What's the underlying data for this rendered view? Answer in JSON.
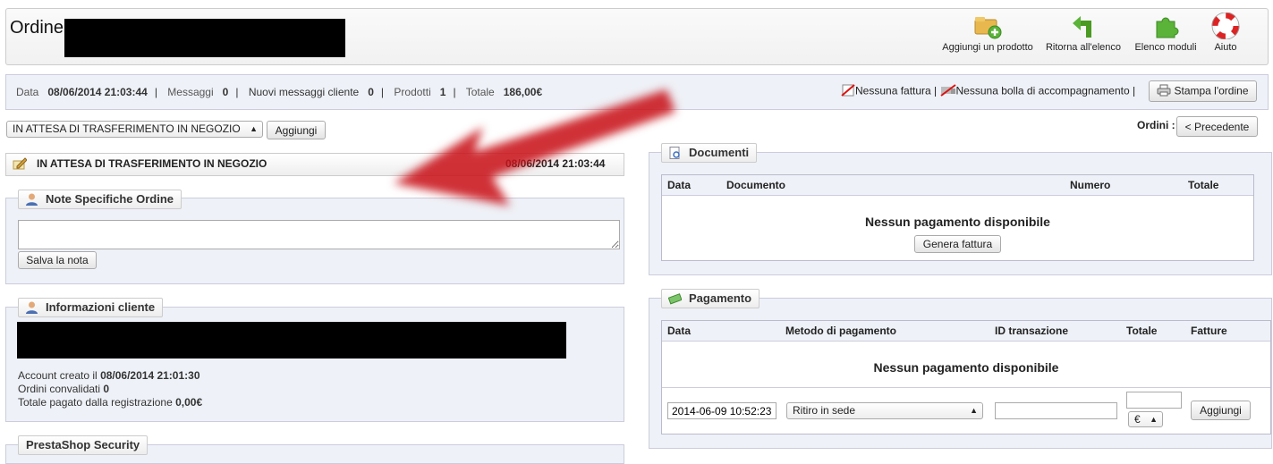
{
  "header": {
    "title": "Ordine",
    "toolbar": [
      {
        "label": "Aggiungi un prodotto",
        "icon": "add-product-icon"
      },
      {
        "label": "Ritorna all'elenco",
        "icon": "back-arrow-icon"
      },
      {
        "label": "Elenco moduli",
        "icon": "puzzle-icon"
      },
      {
        "label": "Aiuto",
        "icon": "lifebuoy-icon"
      }
    ]
  },
  "infobar": {
    "date_label": "Data",
    "date_value": "08/06/2014 21:03:44",
    "messages_label": "Messaggi",
    "messages_value": "0",
    "new_messages_label": "Nuovi messaggi cliente",
    "new_messages_value": "0",
    "products_label": "Prodotti",
    "products_value": "1",
    "total_label": "Totale",
    "total_value": "186,00€",
    "no_invoice": "Nessuna fattura",
    "no_delivery": "Nessuna bolla di accompagnamento",
    "print_order": "Stampa l'ordine"
  },
  "status": {
    "select_value": "IN ATTESA DI TRASFERIMENTO IN NEGOZIO",
    "add_button": "Aggiungi",
    "current_state": "IN ATTESA DI TRASFERIMENTO IN NEGOZIO",
    "current_date": "08/06/2014 21:03:44"
  },
  "nav": {
    "orders_label": "Ordini :",
    "previous_button": "< Precedente"
  },
  "notes": {
    "legend": "Note Specifiche Ordine",
    "textarea_value": "",
    "save_button": "Salva la nota"
  },
  "customer": {
    "legend": "Informazioni cliente",
    "account_created_label": "Account creato il",
    "account_created_value": "08/06/2014 21:01:30",
    "validated_orders_label": "Ordini convalidati",
    "validated_orders_value": "0",
    "total_paid_label": "Totale pagato dalla registrazione",
    "total_paid_value": "0,00€"
  },
  "security": {
    "legend": "PrestaShop Security"
  },
  "documents": {
    "legend": "Documenti",
    "columns": [
      "Data",
      "Documento",
      "Numero",
      "Totale"
    ],
    "empty_message": "Nessun pagamento disponibile",
    "generate_button": "Genera fattura"
  },
  "payment": {
    "legend": "Pagamento",
    "columns": [
      "Data",
      "Metodo di pagamento",
      "ID transazione",
      "Totale",
      "Fatture"
    ],
    "empty_message": "Nessun pagamento disponibile",
    "date_input": "2014-06-09 10:52:23",
    "method_select": "Ritiro in sede",
    "transaction_input": "",
    "amount_input": "",
    "currency_select": "€",
    "add_button": "Aggiungi"
  },
  "colors": {
    "panel_bg": "#eef1f7",
    "arrow": "#c8151b"
  }
}
